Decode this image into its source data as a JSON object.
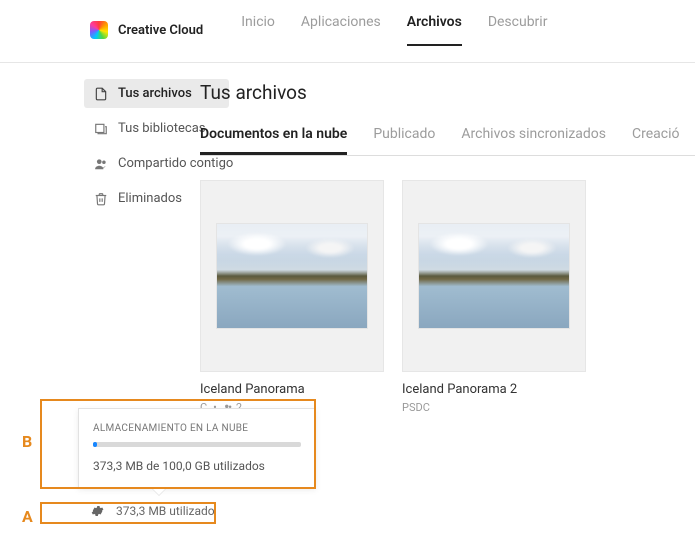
{
  "brand": "Creative Cloud",
  "nav": {
    "inicio": "Inicio",
    "aplicaciones": "Aplicaciones",
    "archivos": "Archivos",
    "descubrir": "Descubrir"
  },
  "sidebar": {
    "tus_archivos": "Tus archivos",
    "tus_bibliotecas": "Tus bibliotecas",
    "compartido": "Compartido contigo",
    "eliminados": "Eliminados"
  },
  "page": {
    "title": "Tus archivos"
  },
  "tabs": {
    "documentos": "Documentos en la nube",
    "publicado": "Publicado",
    "sincronizados": "Archivos sincronizados",
    "creacion": "Creació"
  },
  "files": [
    {
      "name": "Iceland Panorama",
      "type_fragment": "C",
      "dot": "•",
      "people": "2"
    },
    {
      "name": "Iceland Panorama 2",
      "type": "PSDC"
    }
  ],
  "storage": {
    "tooltip_title": "ALMACENAMIENTO EN LA NUBE",
    "tooltip_line": "373,3 MB de 100,0 GB utilizados",
    "footer_line": "373,3 MB utilizado"
  },
  "callouts": {
    "A": "A",
    "B": "B"
  }
}
